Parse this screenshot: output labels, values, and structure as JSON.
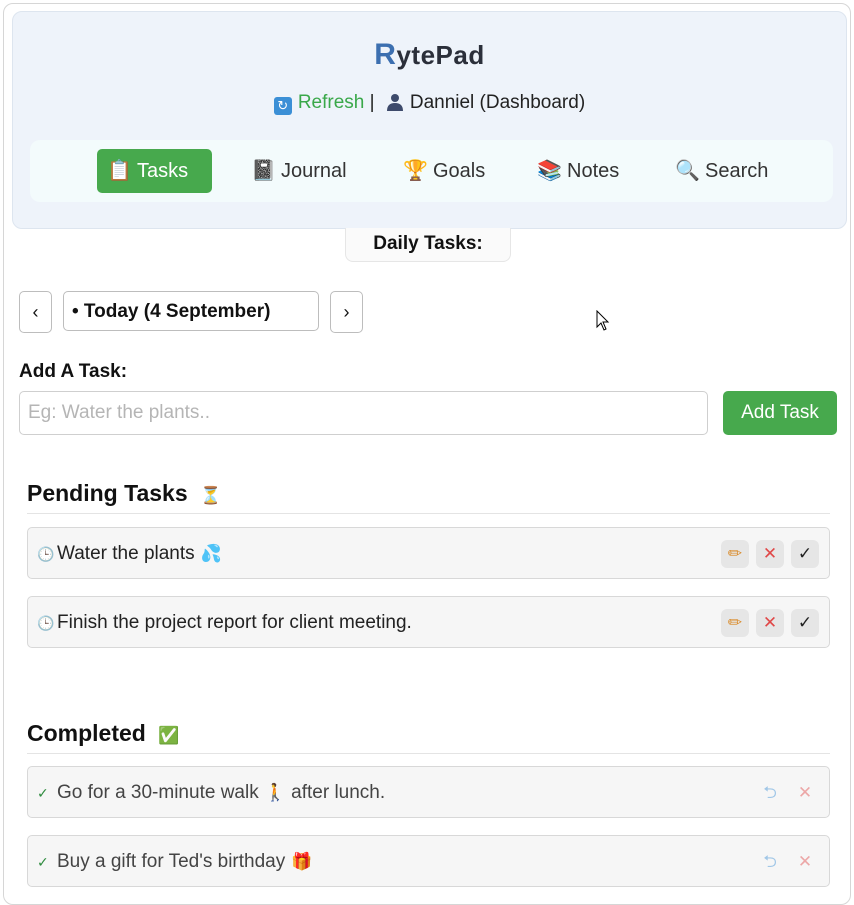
{
  "app": {
    "name_first": "R",
    "name_rest": "ytePad"
  },
  "header": {
    "refresh_label": "Refresh",
    "separator": "|",
    "user_label": "Danniel (Dashboard)"
  },
  "nav": [
    {
      "label": "Tasks",
      "icon": "clipboard-icon",
      "glyph": "📋",
      "active": true
    },
    {
      "label": "Journal",
      "icon": "notebook-icon",
      "glyph": "📓",
      "active": false
    },
    {
      "label": "Goals",
      "icon": "trophy-icon",
      "glyph": "🏆",
      "active": false
    },
    {
      "label": "Notes",
      "icon": "books-icon",
      "glyph": "📚",
      "active": false
    },
    {
      "label": "Search",
      "icon": "magnifier-icon",
      "glyph": "🔍",
      "active": false
    }
  ],
  "daily_tab": "Daily Tasks:",
  "date_nav": {
    "prev": "‹",
    "current": "• Today (4 September)",
    "next": "›"
  },
  "add_task": {
    "label": "Add A Task:",
    "placeholder": "Eg: Water the plants..",
    "button": "Add Task"
  },
  "pending": {
    "title": "Pending Tasks",
    "title_emoji": "⏳",
    "items": [
      {
        "marker": "🕒",
        "text": "Water the plants",
        "emoji": "💦"
      },
      {
        "marker": "🕒",
        "text": "Finish the project report for client meeting.",
        "emoji": ""
      }
    ],
    "actions": {
      "edit": "✏",
      "delete": "✕",
      "complete": "✓"
    }
  },
  "completed": {
    "title": "Completed",
    "title_emoji": "✅",
    "items": [
      {
        "marker": "✓",
        "text_before": "Go for a 30-minute walk",
        "emoji": "🚶",
        "text_after": "after lunch."
      },
      {
        "marker": "✓",
        "text_before": "Buy a gift for Ted's birthday",
        "emoji": "🎁",
        "text_after": ""
      }
    ],
    "actions": {
      "undo": "⮌",
      "delete": "✕"
    }
  },
  "colors": {
    "accent_green": "#47a94d",
    "header_bg": "#eef3fa",
    "delete_red": "#e04848"
  }
}
